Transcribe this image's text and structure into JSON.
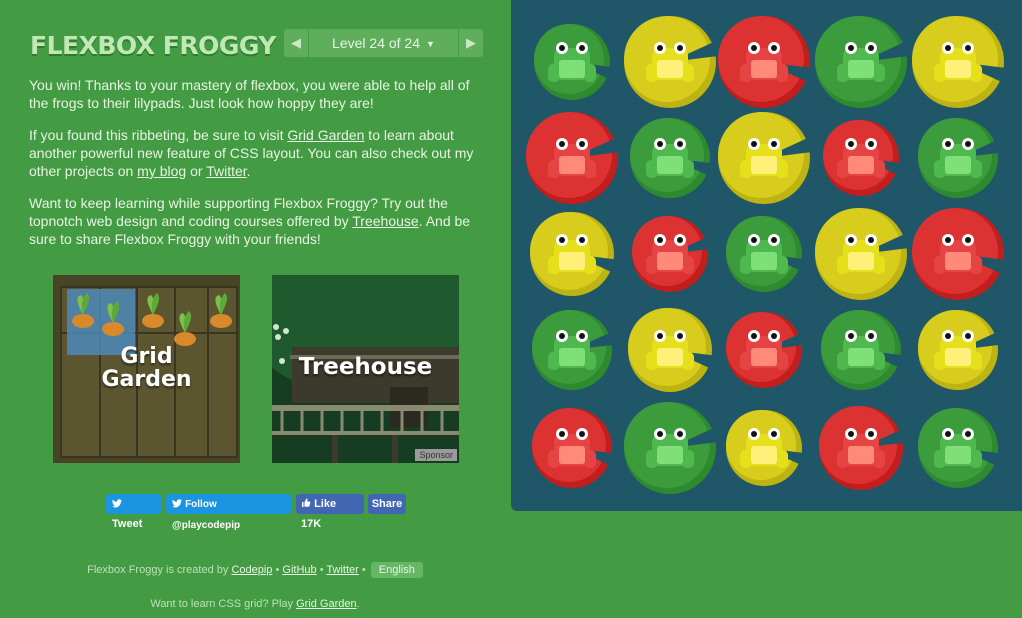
{
  "header": {
    "logo": "FLEXBOX FROGGY",
    "level_label": "Level 24 of 24",
    "level_caret": "▼",
    "prev_arrow": "◀",
    "next_arrow": "▶"
  },
  "content": {
    "p1": "You win! Thanks to your mastery of flexbox, you were able to help all of the frogs to their lilypads. Just look how hoppy they are!",
    "p2_a": "If you found this ribbeting, be sure to visit ",
    "p2_link1": "Grid Garden",
    "p2_b": " to learn about another powerful new feature of CSS layout. You can also check out my other projects on ",
    "p2_link2": "my blog",
    "p2_c": " or ",
    "p2_link3": "Twitter",
    "p2_d": ".",
    "p3_a": "Want to keep learning while supporting Flexbox Froggy? Try out the topnotch web design and coding courses offered by ",
    "p3_link": "Treehouse",
    "p3_b": ". And be sure to share Flexbox Froggy with your friends!"
  },
  "promos": {
    "grid_garden_line1": "Grid",
    "grid_garden_line2": "Garden",
    "treehouse": "Treehouse",
    "sponsor": "Sponsor"
  },
  "social": {
    "tweet": "Tweet",
    "follow": "Follow @playcodepip",
    "like": "Like 17K",
    "share": "Share"
  },
  "footer": {
    "created_by": "Flexbox Froggy is created by ",
    "codepip": "Codepip",
    "sep": " • ",
    "github": "GitHub",
    "twitter": "Twitter",
    "language": "English",
    "grid_text": "Want to learn CSS grid? Play ",
    "grid_link": "Grid Garden",
    "grid_end": "."
  },
  "colors": {
    "green": "#3a9a3a",
    "yellow": "#d2c71a",
    "red": "#d42a2a",
    "board_bg": "#1f5768",
    "page_bg": "#439b43"
  },
  "board": {
    "rows": [
      [
        "green",
        "yellow",
        "red",
        "green",
        "yellow"
      ],
      [
        "red",
        "green",
        "yellow",
        "red",
        "green"
      ],
      [
        "yellow",
        "red",
        "green",
        "yellow",
        "red"
      ],
      [
        "green",
        "yellow",
        "red",
        "green",
        "yellow"
      ],
      [
        "red",
        "green",
        "yellow",
        "red",
        "green"
      ]
    ],
    "frogs": [
      [
        "green",
        "yellow",
        "red",
        "green",
        "yellow"
      ],
      [
        "red",
        "green",
        "yellow",
        "red",
        "green"
      ],
      [
        "yellow",
        "red",
        "green",
        "yellow",
        "red"
      ],
      [
        "green",
        "yellow",
        "red",
        "green",
        "yellow"
      ],
      [
        "red",
        "green",
        "yellow",
        "red",
        "green"
      ]
    ]
  }
}
